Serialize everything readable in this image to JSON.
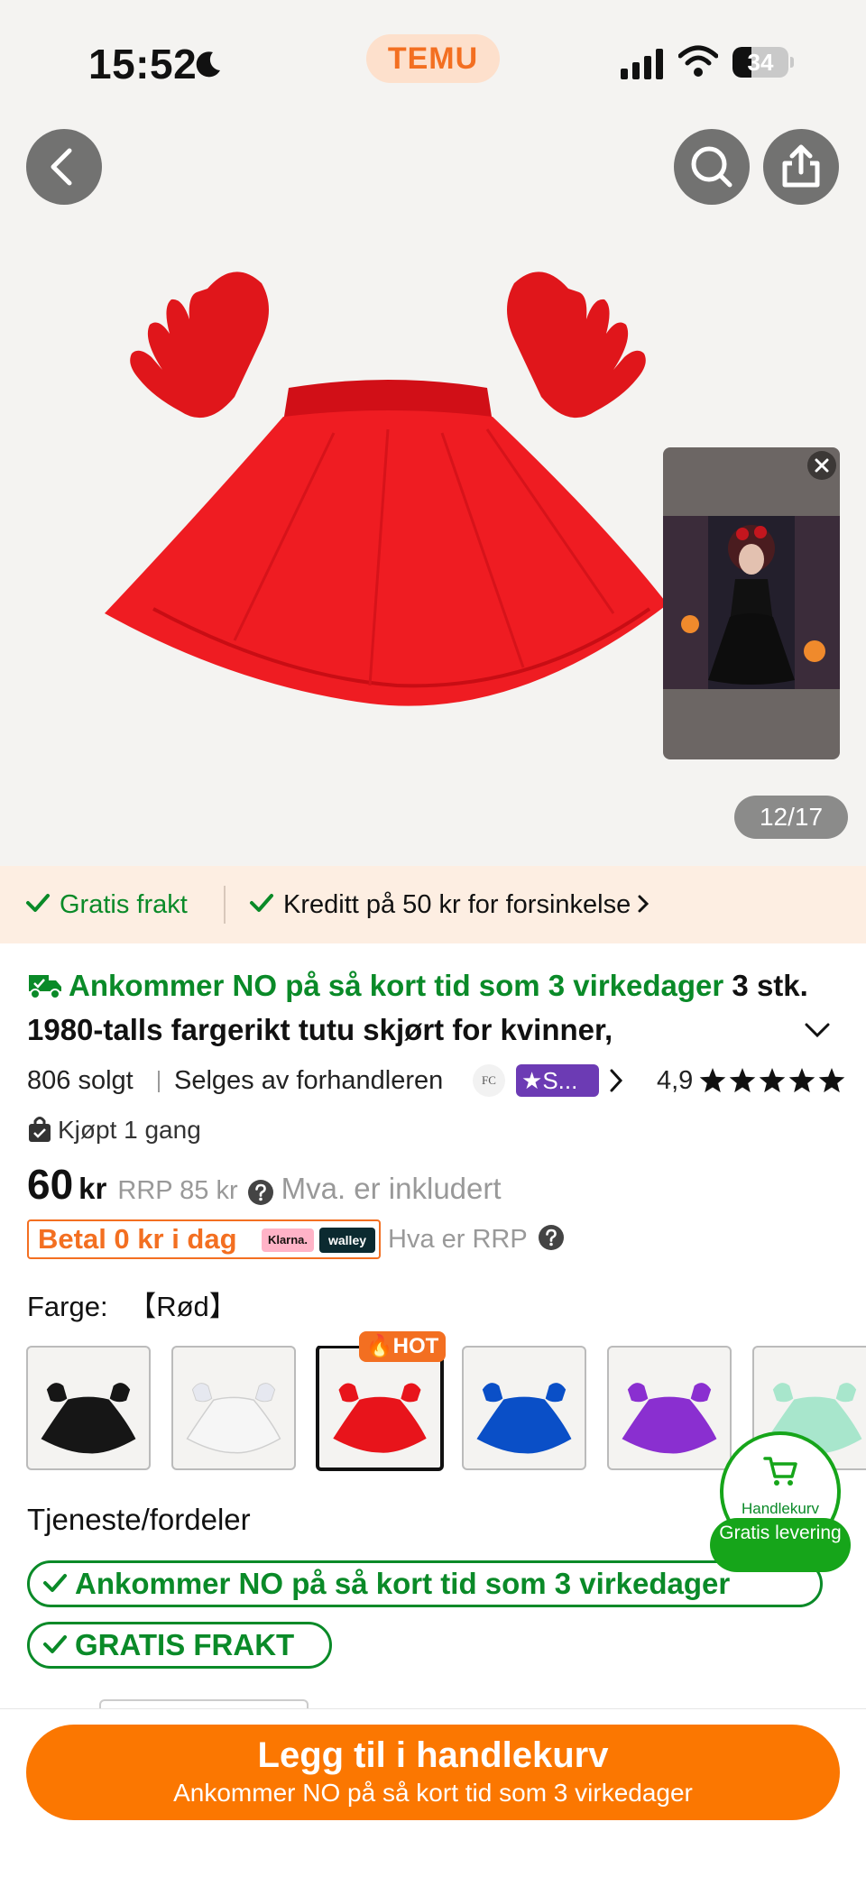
{
  "status_bar": {
    "time": "15:52",
    "brand": "TEMU",
    "battery_percent": 34,
    "battery_label": "34"
  },
  "gallery": {
    "image_counter": "12/17",
    "icons": [
      "back-icon",
      "search-icon",
      "share-icon",
      "close-icon"
    ]
  },
  "shipping_strip": {
    "free_shipping": "Gratis frakt",
    "credit_text": "Kreditt på 50 kr for forsinkelse"
  },
  "product": {
    "arrival_text": "Ankommer NO på så kort tid som 3 virkedager",
    "title": "3 stk. 1980-talls fargerikt tutu skjørt for kvinner,",
    "sold": "806 solgt",
    "seller_text": "Selges av forhandleren",
    "seller_logo_text": "FC",
    "store_badge": "S...",
    "rating": "4,9",
    "rating_stars": 5,
    "bought_text": "Kjøpt 1 gang"
  },
  "price": {
    "amount": "60",
    "currency": "kr",
    "rrp": "RRP 85 kr",
    "vat": "Mva. er inkludert",
    "pay_later": "Betal 0 kr i dag",
    "klarna": "Klarna.",
    "walley": "walley",
    "rrp_link": "Hva er RRP"
  },
  "color": {
    "label": "Farge:",
    "selected": "【Rød】",
    "hot_badge": "HOT",
    "swatches": [
      {
        "name": "black",
        "hex": "#161616"
      },
      {
        "name": "white",
        "hex": "#f6f6f6"
      },
      {
        "name": "red",
        "hex": "#e8141b"
      },
      {
        "name": "blue",
        "hex": "#0a4fc7"
      },
      {
        "name": "purple",
        "hex": "#8a2fd0"
      },
      {
        "name": "mint",
        "hex": "#a8e6cc"
      }
    ]
  },
  "services": {
    "label": "Tjeneste/fordeler",
    "chips": [
      "Ankommer NO på så kort tid som 3 virkedager",
      "GRATIS FRAKT"
    ]
  },
  "cart_fab": {
    "label": "Handlekurv",
    "free_delivery": "Gratis levering"
  },
  "cta": {
    "title": "Legg til i handlekurv",
    "subtitle": "Ankommer NO på så kort tid som 3 virkedager"
  },
  "colors": {
    "accent_orange": "#fb7701",
    "brand_orange": "#f36f21",
    "success_green": "#0a8a28",
    "strip_background": "#fdeee2"
  }
}
